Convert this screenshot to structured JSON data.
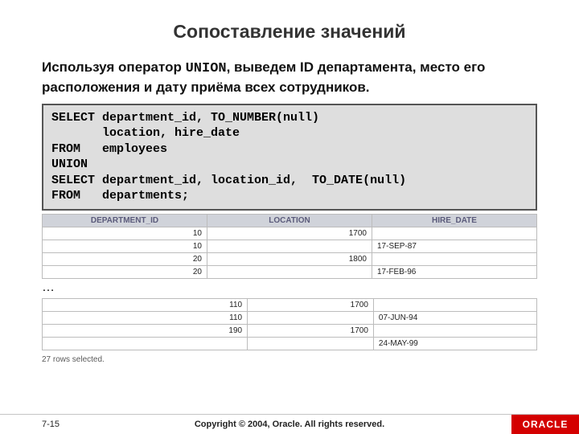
{
  "title": "Сопоставление значений",
  "intro_html": "Используя оператор <span class=\"mono\">UNION</span>, выведем ID департамента, место его расположения и дату приёма всех сотрудников.",
  "code": "SELECT department_id, TO_NUMBER(null)\n       location, hire_date\nFROM   employees\nUNION\nSELECT department_id, location_id,  TO_DATE(null)\nFROM   departments;",
  "columns": [
    "DEPARTMENT_ID",
    "LOCATION",
    "HIRE_DATE"
  ],
  "rows_top": [
    {
      "dept": "10",
      "loc": "1700",
      "hire": ""
    },
    {
      "dept": "10",
      "loc": "",
      "hire": "17-SEP-87"
    },
    {
      "dept": "20",
      "loc": "1800",
      "hire": ""
    },
    {
      "dept": "20",
      "loc": "",
      "hire": "17-FEB-96"
    }
  ],
  "ellipsis": "…",
  "rows_bottom": [
    {
      "dept": "110",
      "loc": "1700",
      "hire": ""
    },
    {
      "dept": "110",
      "loc": "",
      "hire": "07-JUN-94"
    },
    {
      "dept": "190",
      "loc": "1700",
      "hire": ""
    },
    {
      "dept": "",
      "loc": "",
      "hire": "24-MAY-99"
    }
  ],
  "rowcount": "27 rows selected.",
  "footer": {
    "page": "7-15",
    "copyright": "Copyright © 2004, Oracle.  All rights reserved.",
    "logo": "ORACLE"
  }
}
